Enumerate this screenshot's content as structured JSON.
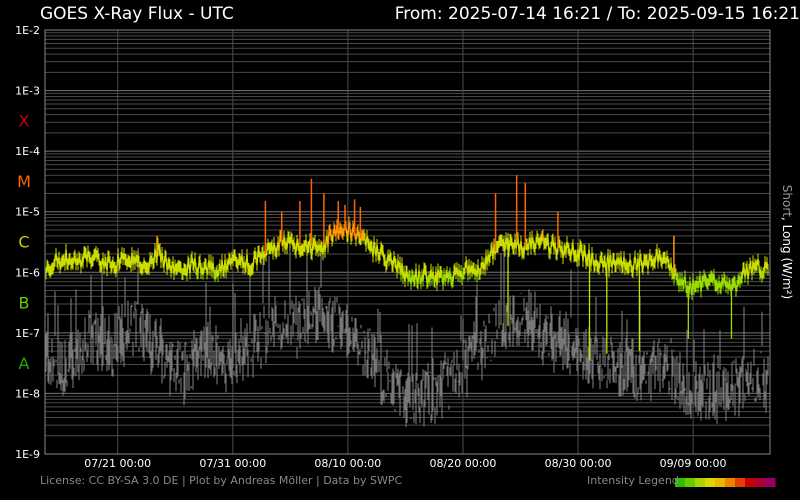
{
  "header": {
    "title": "GOES X-Ray Flux - UTC",
    "range_from_label": "From:",
    "range_from": "2025-07-14 16:21",
    "range_sep": "/",
    "range_to_label": "To:",
    "range_to": "2025-09-15 16:21"
  },
  "footer": {
    "license": "License: CC BY-SA 3.0 DE | Plot by Andreas Möller | Data by SWPC",
    "legend_label": "Intensity Legend"
  },
  "axis": {
    "y_label_short": "Short",
    "y_label_rest": ", Long (W/m²)"
  },
  "chart_data": {
    "type": "line",
    "title": "GOES X-Ray Flux - UTC",
    "x_range": [
      "2025-07-14 16:21",
      "2025-09-15 16:21"
    ],
    "yscale": "log",
    "ylim": [
      1e-09,
      0.01
    ],
    "yticks": [
      "1E-2",
      "1E-3",
      "1E-4",
      "1E-5",
      "1E-6",
      "1E-7",
      "1E-8",
      "1E-9"
    ],
    "ytick_values": [
      0.01,
      0.001,
      0.0001,
      1e-05,
      1e-06,
      1e-07,
      1e-08,
      1e-09
    ],
    "xticks": [
      {
        "date": "2025-07-21 00:00",
        "label": "07/21 00:00"
      },
      {
        "date": "2025-07-31 00:00",
        "label": "07/31 00:00"
      },
      {
        "date": "2025-08-10 00:00",
        "label": "08/10 00:00"
      },
      {
        "date": "2025-08-20 00:00",
        "label": "08/20 00:00"
      },
      {
        "date": "2025-08-30 00:00",
        "label": "08/30 00:00"
      },
      {
        "date": "2025-09-09 00:00",
        "label": "09/09 00:00"
      }
    ],
    "flare_classes": [
      {
        "label": "X",
        "value": 0.00032,
        "color": "#cc0000"
      },
      {
        "label": "M",
        "value": 3.2e-05,
        "color": "#ff6600"
      },
      {
        "label": "C",
        "value": 3.2e-06,
        "color": "#cccc00"
      },
      {
        "label": "B",
        "value": 3.2e-07,
        "color": "#66cc00"
      },
      {
        "label": "A",
        "value": 3.2e-08,
        "color": "#22aa00"
      }
    ],
    "grid": true,
    "legend_colors": [
      "#33bb00",
      "#66cc00",
      "#aad400",
      "#d8d800",
      "#e8b800",
      "#f08000",
      "#e04000",
      "#cc0000",
      "#aa0033",
      "#990066"
    ],
    "series": [
      {
        "name": "Long",
        "points": [
          [
            "2025-07-14 16:00",
            1.2e-06
          ],
          [
            "2025-07-15 12:00",
            1.5e-06
          ],
          [
            "2025-07-16 12:00",
            1.8e-06
          ],
          [
            "2025-07-17 12:00",
            1.4e-06
          ],
          [
            "2025-07-18 12:00",
            2e-06
          ],
          [
            "2025-07-19 12:00",
            1.6e-06
          ],
          [
            "2025-07-20 12:00",
            1.3e-06
          ],
          [
            "2025-07-21 12:00",
            1.7e-06
          ],
          [
            "2025-07-22 12:00",
            1.5e-06
          ],
          [
            "2025-07-23 12:00",
            1.2e-06
          ],
          [
            "2025-07-24 12:00",
            2.2e-06
          ],
          [
            "2025-07-25 12:00",
            1.1e-06
          ],
          [
            "2025-07-26 12:00",
            1e-06
          ],
          [
            "2025-07-27 12:00",
            1.4e-06
          ],
          [
            "2025-07-28 12:00",
            1.2e-06
          ],
          [
            "2025-07-29 12:00",
            1.1e-06
          ],
          [
            "2025-07-30 12:00",
            1.3e-06
          ],
          [
            "2025-07-31 12:00",
            1.5e-06
          ],
          [
            "2025-08-01 12:00",
            1.4e-06
          ],
          [
            "2025-08-02 12:00",
            1.8e-06
          ],
          [
            "2025-08-03 12:00",
            2.5e-06
          ],
          [
            "2025-08-04 12:00",
            3.5e-06
          ],
          [
            "2025-08-05 12:00",
            2.8e-06
          ],
          [
            "2025-08-06 12:00",
            3e-06
          ],
          [
            "2025-08-07 12:00",
            2.2e-06
          ],
          [
            "2025-08-08 12:00",
            4e-06
          ],
          [
            "2025-08-09 12:00",
            5.5e-06
          ],
          [
            "2025-08-10 12:00",
            4.5e-06
          ],
          [
            "2025-08-11 12:00",
            3.2e-06
          ],
          [
            "2025-08-12 12:00",
            2.2e-06
          ],
          [
            "2025-08-13 12:00",
            1.6e-06
          ],
          [
            "2025-08-14 12:00",
            1.1e-06
          ],
          [
            "2025-08-15 12:00",
            8e-07
          ],
          [
            "2025-08-16 12:00",
            9e-07
          ],
          [
            "2025-08-17 12:00",
            8e-07
          ],
          [
            "2025-08-18 12:00",
            8.5e-07
          ],
          [
            "2025-08-19 12:00",
            9e-07
          ],
          [
            "2025-08-20 12:00",
            1.2e-06
          ],
          [
            "2025-08-21 12:00",
            1e-06
          ],
          [
            "2025-08-22 12:00",
            2e-06
          ],
          [
            "2025-08-23 12:00",
            2.8e-06
          ],
          [
            "2025-08-24 12:00",
            3.2e-06
          ],
          [
            "2025-08-25 12:00",
            2.5e-06
          ],
          [
            "2025-08-26 12:00",
            3.5e-06
          ],
          [
            "2025-08-27 12:00",
            2.8e-06
          ],
          [
            "2025-08-28 12:00",
            2.4e-06
          ],
          [
            "2025-08-29 12:00",
            2.2e-06
          ],
          [
            "2025-08-30 12:00",
            2e-06
          ],
          [
            "2025-08-31 12:00",
            1.6e-06
          ],
          [
            "2025-09-01 12:00",
            1.4e-06
          ],
          [
            "2025-09-02 12:00",
            1.5e-06
          ],
          [
            "2025-09-03 12:00",
            1.3e-06
          ],
          [
            "2025-09-04 12:00",
            1.4e-06
          ],
          [
            "2025-09-05 12:00",
            1.6e-06
          ],
          [
            "2025-09-06 12:00",
            2e-06
          ],
          [
            "2025-09-07 12:00",
            8e-07
          ],
          [
            "2025-09-08 12:00",
            6e-07
          ],
          [
            "2025-09-09 12:00",
            6e-07
          ],
          [
            "2025-09-10 12:00",
            7e-07
          ],
          [
            "2025-09-11 12:00",
            6.5e-07
          ],
          [
            "2025-09-12 12:00",
            6e-07
          ],
          [
            "2025-09-13 12:00",
            1e-06
          ],
          [
            "2025-09-14 12:00",
            1.2e-06
          ],
          [
            "2025-09-15 16:00",
            1.1e-06
          ]
        ],
        "spikes": [
          [
            "2025-07-24 10:00",
            4e-06
          ],
          [
            "2025-08-02 20:00",
            1.5e-05
          ],
          [
            "2025-08-04 06:00",
            1e-05
          ],
          [
            "2025-08-05 20:00",
            1.5e-05
          ],
          [
            "2025-08-06 20:00",
            3.5e-05
          ],
          [
            "2025-08-07 22:00",
            2e-05
          ],
          [
            "2025-08-09 04:00",
            1.5e-05
          ],
          [
            "2025-08-09 18:00",
            1.3e-05
          ],
          [
            "2025-08-10 14:00",
            1.6e-05
          ],
          [
            "2025-08-11 02:00",
            1.2e-05
          ],
          [
            "2025-08-22 20:00",
            2e-05
          ],
          [
            "2025-08-24 16:00",
            4e-05
          ],
          [
            "2025-08-25 10:00",
            3e-05
          ],
          [
            "2025-08-28 06:00",
            1e-05
          ],
          [
            "2025-09-07 08:00",
            4e-06
          ]
        ],
        "dips": [
          [
            "2025-08-23 22:00",
            1.3e-07
          ],
          [
            "2025-08-31 00:00",
            3.5e-08
          ],
          [
            "2025-09-01 12:00",
            4.5e-08
          ],
          [
            "2025-09-04 08:00",
            5e-08
          ],
          [
            "2025-09-08 14:00",
            8e-08
          ],
          [
            "2025-09-12 08:00",
            8e-08
          ]
        ]
      },
      {
        "name": "Short",
        "color": "#777777",
        "points": [
          [
            "2025-07-14 16:00",
            4e-08
          ],
          [
            "2025-07-16 12:00",
            3e-08
          ],
          [
            "2025-07-18 12:00",
            8e-08
          ],
          [
            "2025-07-20 12:00",
            6e-08
          ],
          [
            "2025-07-22 12:00",
            1.5e-07
          ],
          [
            "2025-07-24 12:00",
            5e-08
          ],
          [
            "2025-07-26 12:00",
            2e-08
          ],
          [
            "2025-07-28 12:00",
            5e-08
          ],
          [
            "2025-07-30 12:00",
            3e-08
          ],
          [
            "2025-08-01 12:00",
            5e-08
          ],
          [
            "2025-08-03 12:00",
            1.5e-07
          ],
          [
            "2025-08-05 12:00",
            1.2e-07
          ],
          [
            "2025-08-07 12:00",
            2e-07
          ],
          [
            "2025-08-09 12:00",
            1e-07
          ],
          [
            "2025-08-11 12:00",
            5e-08
          ],
          [
            "2025-08-13 12:00",
            1.5e-08
          ],
          [
            "2025-08-15 12:00",
            8e-09
          ],
          [
            "2025-08-17 12:00",
            1e-08
          ],
          [
            "2025-08-19 12:00",
            2e-08
          ],
          [
            "2025-08-21 12:00",
            5e-08
          ],
          [
            "2025-08-23 12:00",
            1.2e-07
          ],
          [
            "2025-08-25 12:00",
            2e-07
          ],
          [
            "2025-08-27 12:00",
            8e-08
          ],
          [
            "2025-08-29 12:00",
            6e-08
          ],
          [
            "2025-08-31 12:00",
            3e-08
          ],
          [
            "2025-09-02 12:00",
            3e-08
          ],
          [
            "2025-09-04 12:00",
            2e-08
          ],
          [
            "2025-09-06 12:00",
            3e-08
          ],
          [
            "2025-09-08 12:00",
            1e-08
          ],
          [
            "2025-09-10 12:00",
            1e-08
          ],
          [
            "2025-09-12 12:00",
            1.2e-08
          ],
          [
            "2025-09-14 12:00",
            2e-08
          ],
          [
            "2025-09-15 16:00",
            1.5e-08
          ]
        ]
      }
    ]
  }
}
